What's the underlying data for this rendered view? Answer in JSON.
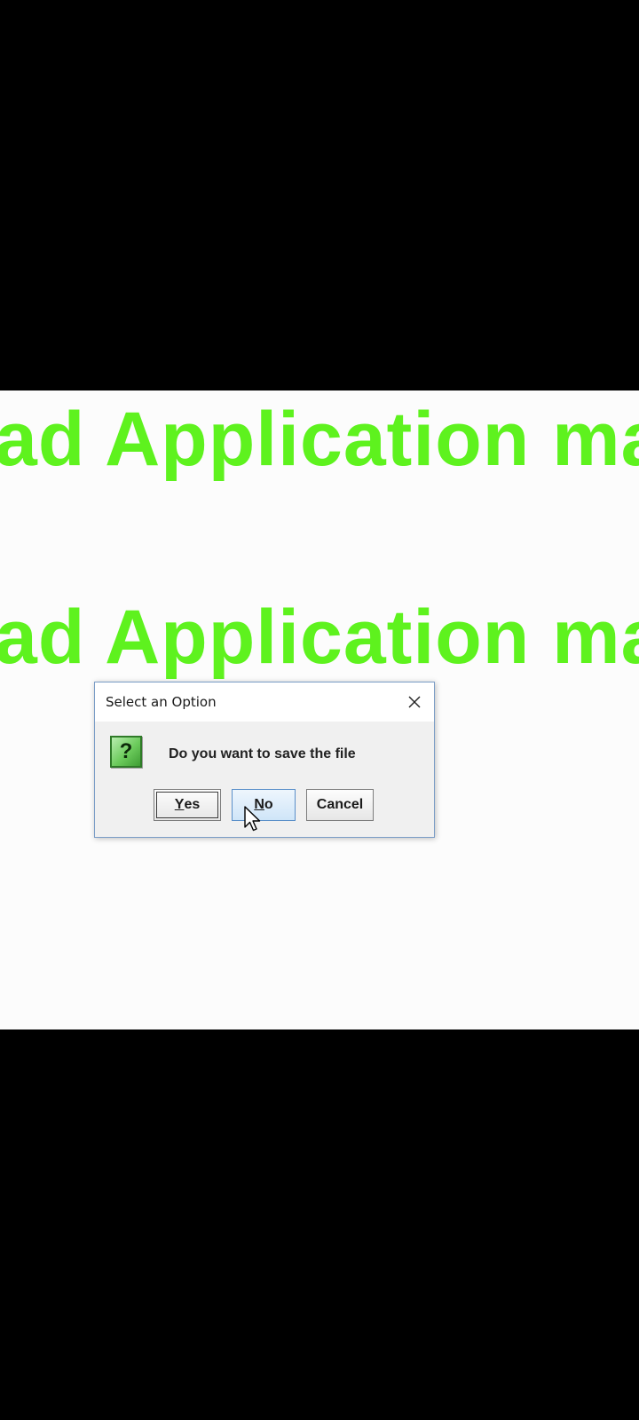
{
  "background": {
    "banner_line_1": "ad Application ma",
    "banner_line_2": "ad Application ma",
    "banner_color": "#5ef21e"
  },
  "dialog": {
    "title": "Select an Option",
    "close_icon": "close-icon",
    "question_icon": "question-icon",
    "question_glyph": "?",
    "message": "Do you want to save the file",
    "buttons": {
      "yes_mnemonic": "Y",
      "yes_rest": "es",
      "no_mnemonic": "N",
      "no_rest": "o",
      "cancel": "Cancel"
    }
  },
  "cursor": {
    "icon": "mouse-pointer-icon",
    "hovering": "no-button"
  }
}
